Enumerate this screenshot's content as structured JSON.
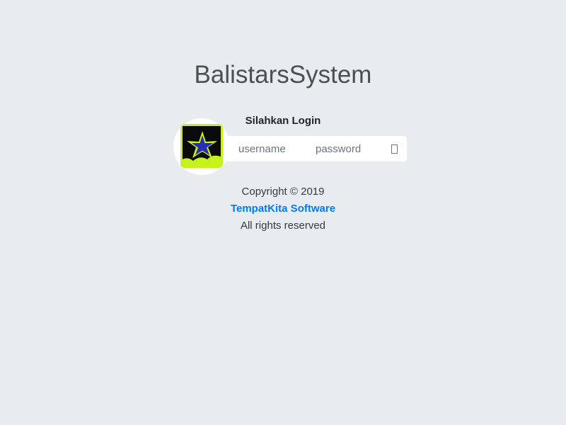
{
  "logo": {
    "brand_bold": "Balistars",
    "brand_light": "System"
  },
  "login": {
    "heading": "Silahkan Login",
    "username_placeholder": "username",
    "password_placeholder": "password",
    "submit_icon": "arrow-right-icon"
  },
  "footer": {
    "copyright": "Copyright © 2019",
    "company_link": "TempatKita Software",
    "rights": "All rights reserved"
  },
  "colors": {
    "background": "#e9ecef",
    "link": "#007bff",
    "avatar_lime": "#c6f21b",
    "avatar_star": "#2a2fb0"
  }
}
